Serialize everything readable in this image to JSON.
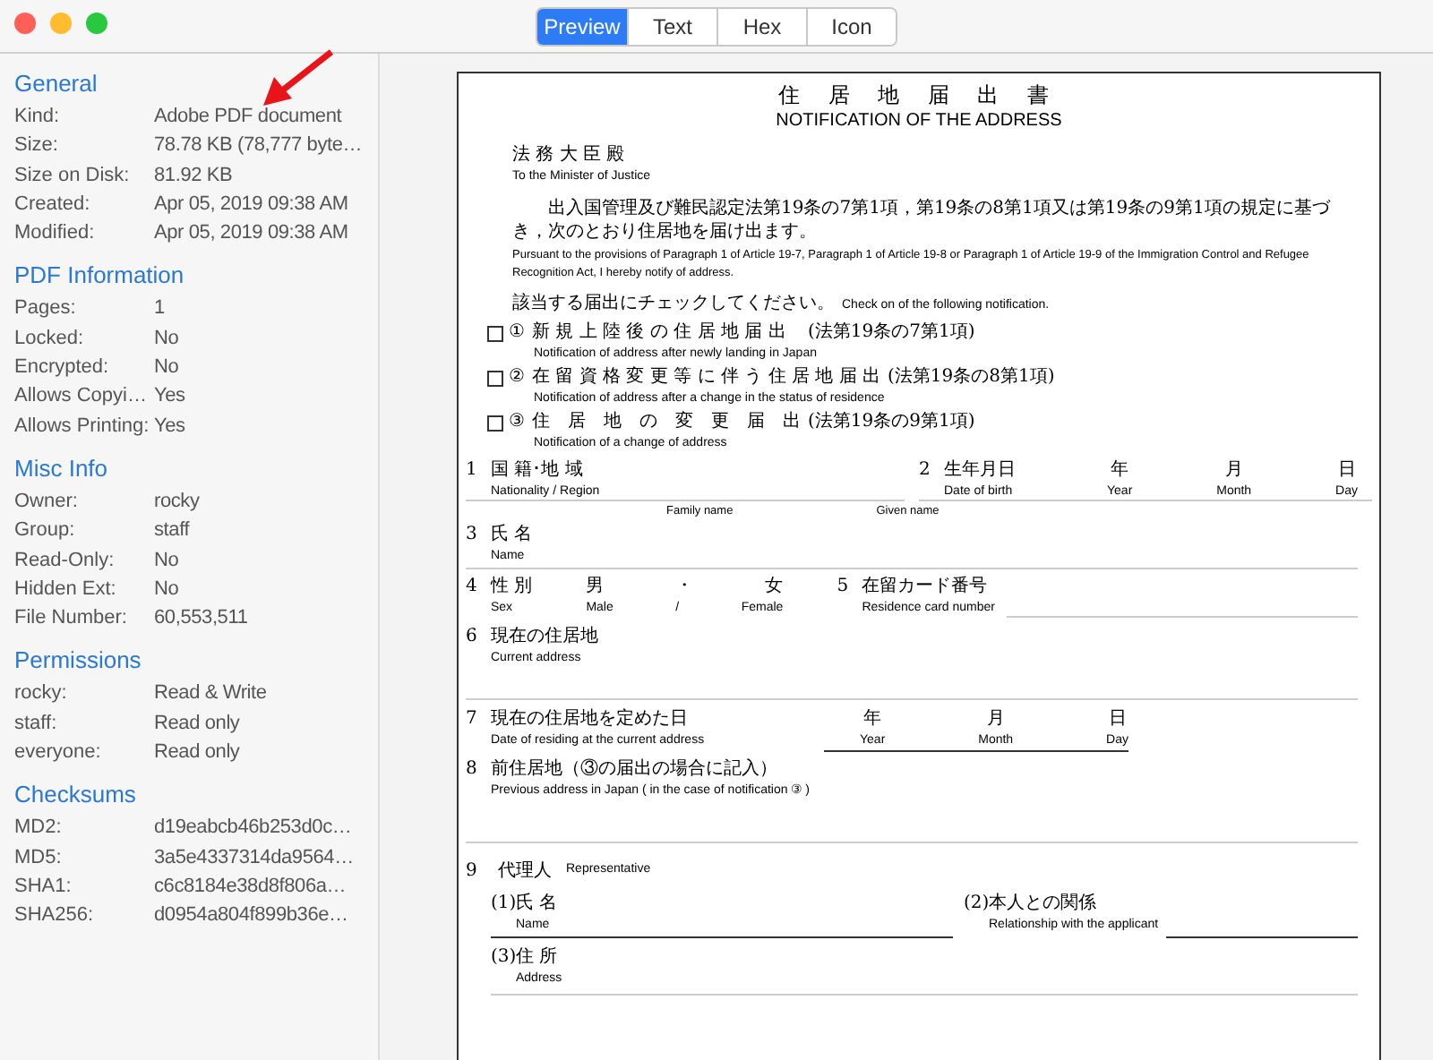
{
  "toolbar": {
    "tabs": [
      {
        "label": "Preview",
        "selected": true
      },
      {
        "label": "Text",
        "selected": false
      },
      {
        "label": "Hex",
        "selected": false
      },
      {
        "label": "Icon",
        "selected": false
      }
    ]
  },
  "sidebar": {
    "sections": [
      {
        "title": "General",
        "rows": [
          {
            "label": "Kind:",
            "value": "Adobe PDF document"
          },
          {
            "label": "Size:",
            "value": "78.78 KB (78,777 byte…"
          },
          {
            "label": "Size on Disk:",
            "value": "81.92 KB"
          },
          {
            "label": "Created:",
            "value": "Apr 05, 2019 09:38 AM"
          },
          {
            "label": "Modified:",
            "value": "Apr 05, 2019 09:38 AM"
          }
        ]
      },
      {
        "title": "PDF Information",
        "rows": [
          {
            "label": "Pages:",
            "value": "1"
          },
          {
            "label": "Locked:",
            "value": "No"
          },
          {
            "label": "Encrypted:",
            "value": "No"
          },
          {
            "label": "Allows Copyi…",
            "value": "Yes"
          },
          {
            "label": "Allows Printing:",
            "value": "Yes"
          }
        ]
      },
      {
        "title": "Misc Info",
        "rows": [
          {
            "label": "Owner:",
            "value": "rocky"
          },
          {
            "label": "Group:",
            "value": "staff"
          },
          {
            "label": "Read-Only:",
            "value": "No"
          },
          {
            "label": "Hidden Ext:",
            "value": "No"
          },
          {
            "label": "File Number:",
            "value": "60,553,511"
          }
        ]
      },
      {
        "title": "Permissions",
        "rows": [
          {
            "label": "rocky:",
            "value": "Read & Write"
          },
          {
            "label": "staff:",
            "value": "Read only"
          },
          {
            "label": "everyone:",
            "value": "Read only"
          }
        ]
      },
      {
        "title": "Checksums",
        "rows": [
          {
            "label": "MD2:",
            "value": "d19eabcb46b253d0c…"
          },
          {
            "label": "MD5:",
            "value": "3a5e4337314da9564…"
          },
          {
            "label": "SHA1:",
            "value": "c6c8184e38d8f806a…"
          },
          {
            "label": "SHA256:",
            "value": "d0954a804f899b36e…"
          }
        ]
      }
    ]
  },
  "document": {
    "title_ja": "住 居 地 届 出 書",
    "title_en": "NOTIFICATION OF THE ADDRESS",
    "addressee_ja": "法 務 大 臣 殿",
    "addressee_en": "To the Minister of Justice",
    "intro_ja": "出入国管理及び難民認定法第19条の7第1項，第19条の8第1項又は第19条の9第1項の規定に基づき，次のとおり住居地を届け出ます。",
    "intro_en": "Pursuant to the provisions of Paragraph 1 of Article 19-7, Paragraph 1 of Article 19-8 or Paragraph 1 of Article 19-9 of the Immigration Control and Refugee Recognition Act, I hereby notify of address.",
    "instruction_ja": "該当する届出にチェックしてください。",
    "instruction_en": "Check on of the following notification.",
    "options": [
      {
        "checked": false,
        "number": "①",
        "ja": "新 規 上 陸 後 の 住 居 地 届 出",
        "law": "(法第19条の7第1項)",
        "en": "Notification of address after newly landing in Japan"
      },
      {
        "checked": false,
        "number": "②",
        "ja": "在 留 資 格 変 更 等 に 伴 う 住 居 地 届 出",
        "law": "(法第19条の8第1項)",
        "en": "Notification of address after a change in the status of residence"
      },
      {
        "checked": false,
        "number": "③",
        "ja": "住　居　地　の　変　更　届　出",
        "law": "(法第19条の9第1項)",
        "en": "Notification of a change of address"
      }
    ],
    "nationality": {
      "number": "1",
      "ja": "国 籍･地 域",
      "en": "Nationality / Region"
    },
    "birth": {
      "number": "2",
      "ja": "生年月日",
      "en": "Date of birth",
      "parts": [
        {
          "ja": "年",
          "en": "Year"
        },
        {
          "ja": "月",
          "en": "Month"
        },
        {
          "ja": "日",
          "en": "Day"
        }
      ]
    },
    "name_hints": [
      "Family name",
      "Given name"
    ],
    "name": {
      "number": "3",
      "ja": "氏 名",
      "en": "Name"
    },
    "sex": {
      "number": "4",
      "ja": "性 別",
      "en": "Sex",
      "choices_ja": [
        "男",
        "・",
        "女"
      ],
      "choices_en": [
        "Male",
        "/",
        "Female"
      ]
    },
    "card": {
      "number": "5",
      "ja": "在留カード番号",
      "en": "Residence card number"
    },
    "current": {
      "number": "6",
      "ja": "現在の住居地",
      "en": "Current address"
    },
    "since": {
      "number": "7",
      "ja": "現在の住居地を定めた日",
      "en": "Date of residing at the current address",
      "parts": [
        {
          "ja": "年",
          "en": "Year"
        },
        {
          "ja": "月",
          "en": "Month"
        },
        {
          "ja": "日",
          "en": "Day"
        }
      ]
    },
    "previous": {
      "number": "8",
      "ja": "前住居地（③の届出の場合に記入）",
      "en": "Previous address in Japan ( in the case of notification ③ )"
    },
    "representative": {
      "number": "9",
      "ja": "代理人",
      "en": "Representative",
      "items": [
        {
          "number": "(1)",
          "ja": "氏 名",
          "en": "Name"
        },
        {
          "number": "(2)",
          "ja": "本人との関係",
          "en": "Relationship with the applicant"
        },
        {
          "number": "(3)",
          "ja": "住 所",
          "en": "Address"
        }
      ]
    }
  }
}
